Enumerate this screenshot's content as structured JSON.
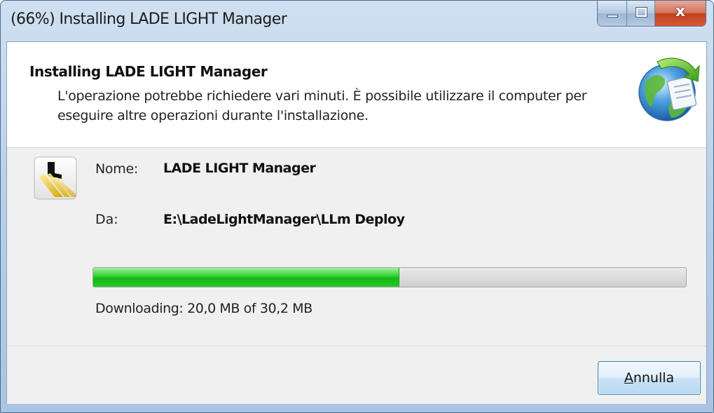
{
  "window": {
    "title": "(66%) Installing LADE LIGHT Manager",
    "buttons": {
      "minimize_icon": "minimize-icon",
      "maximize_icon": "maximize-icon",
      "close_glyph": "x"
    }
  },
  "header": {
    "title": "Installing LADE LIGHT Manager",
    "description": "L'operazione potrebbe richiedere vari minuti. È possibile utilizzare il computer per eseguire altre operazioni durante l'installazione.",
    "icon": "globe-install-icon"
  },
  "details": {
    "app_icon": "lade-light-app-icon",
    "name_label": "Nome:",
    "name_value": "LADE LIGHT Manager",
    "from_label": "Da:",
    "from_value": "E:\\LadeLightManager\\LLm Deploy"
  },
  "progress": {
    "fraction": 0.66,
    "status_text": "Downloading: 20,0 MB of 30,2 MB"
  },
  "footer": {
    "cancel_accel": "A",
    "cancel_rest": "nnulla"
  },
  "colors": {
    "progress_green": "#22c322",
    "titlebar_blue": "#b7cfe8",
    "close_red": "#c2401f",
    "button_border": "#3c7fb1"
  }
}
